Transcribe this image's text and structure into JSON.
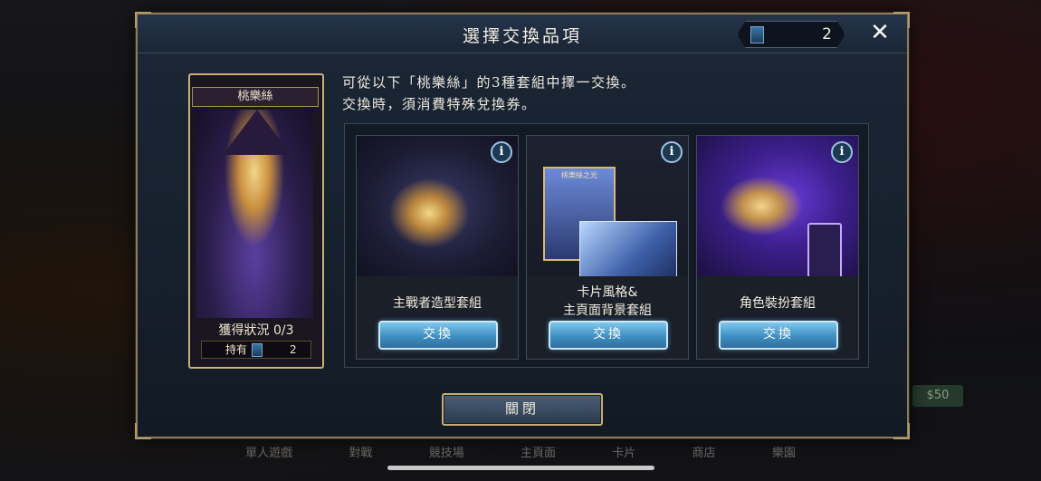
{
  "background": {
    "bottom_nav": [
      "單人遊戲",
      "對戰",
      "競技場",
      "主頁面",
      "卡片",
      "商店",
      "樂園"
    ],
    "side_badge": "$50"
  },
  "modal": {
    "title": "選擇交換品項",
    "ticket_count": "2",
    "close_glyph": "✕",
    "character": {
      "name": "桃樂絲",
      "status": "獲得狀況 0/3",
      "hold_label": "持有",
      "hold_count": "2"
    },
    "description": [
      "可從以下「桃樂絲」的3種套組中擇一交換。",
      "交換時，須消費特殊兌換券。"
    ],
    "options": [
      {
        "label_lines": [
          "主戰者造型套組"
        ],
        "button": "交換",
        "info": "i"
      },
      {
        "label_lines": [
          "卡片風格&",
          "主頁面背景套組"
        ],
        "button": "交換",
        "info": "i",
        "mini_card_title": "桃樂絲之光"
      },
      {
        "label_lines": [
          "角色裝扮套組"
        ],
        "button": "交換",
        "info": "i"
      }
    ],
    "close_button": "關閉"
  },
  "colors": {
    "frame_gold": "#c9b07a",
    "button_blue": "#3f8fc2",
    "panel_bg": "#16202d"
  }
}
